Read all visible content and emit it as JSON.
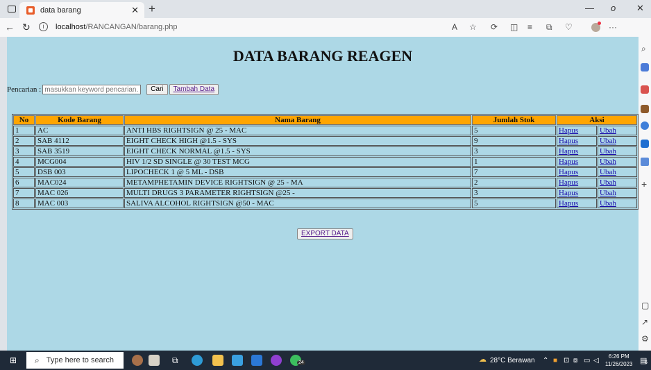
{
  "browser": {
    "tab_title": "data barang",
    "url_host": "localhost",
    "url_path": "/RANCANGAN/barang.php"
  },
  "page": {
    "heading": "DATA BARANG REAGEN",
    "search_label": "Pencarian :",
    "search_placeholder": "masukkan keyword pencarian...",
    "search_value": "",
    "search_button": "Cari",
    "add_button": "Tambah Data",
    "export_button": "EXPORT DATA",
    "table": {
      "headers": {
        "no": "No",
        "kode": "Kode Barang",
        "nama": "Nama Barang",
        "stok": "Jumlah Stok",
        "aksi": "Aksi"
      },
      "action_delete": "Hapus",
      "action_edit": "Ubah",
      "rows": [
        {
          "no": "1",
          "kode": "AC",
          "nama": "ANTI HBS RIGHTSIGN @ 25 - MAC",
          "stok": "5"
        },
        {
          "no": "2",
          "kode": "SAB 4112",
          "nama": "EIGHT CHECK HIGH @1.5 - SYS",
          "stok": "9"
        },
        {
          "no": "3",
          "kode": "SAB 3519",
          "nama": "EIGHT CHECK NORMAL @1.5 - SYS",
          "stok": "3"
        },
        {
          "no": "4",
          "kode": "MCG004",
          "nama": "HIV 1/2 SD SINGLE @ 30 TEST MCG",
          "stok": "1"
        },
        {
          "no": "5",
          "kode": "DSB 003",
          "nama": "LIPOCHECK 1 @ 5 ML - DSB",
          "stok": "7"
        },
        {
          "no": "6",
          "kode": "MAC024",
          "nama": "METAMPHETAMIN DEVICE RIGHTSIGN @ 25 - MA",
          "stok": "2"
        },
        {
          "no": "7",
          "kode": "MAC 026",
          "nama": "MULTI DRUGS 3 PARAMETER RIGHTSIGN @25 -",
          "stok": "3"
        },
        {
          "no": "8",
          "kode": "MAC 003",
          "nama": "SALIVA ALCOHOL RIGHTSIGN @50 - MAC",
          "stok": "5"
        }
      ]
    }
  },
  "taskbar": {
    "search_placeholder": "Type here to search",
    "weather": "28°C Berawan",
    "time": "6:26 PM",
    "date": "11/26/2023",
    "chat_badge": "24",
    "notif_badge": "6"
  },
  "colors": {
    "page_bg": "#add8e6",
    "header_bg": "#ffa500",
    "taskbar_bg": "#1f2a38"
  }
}
